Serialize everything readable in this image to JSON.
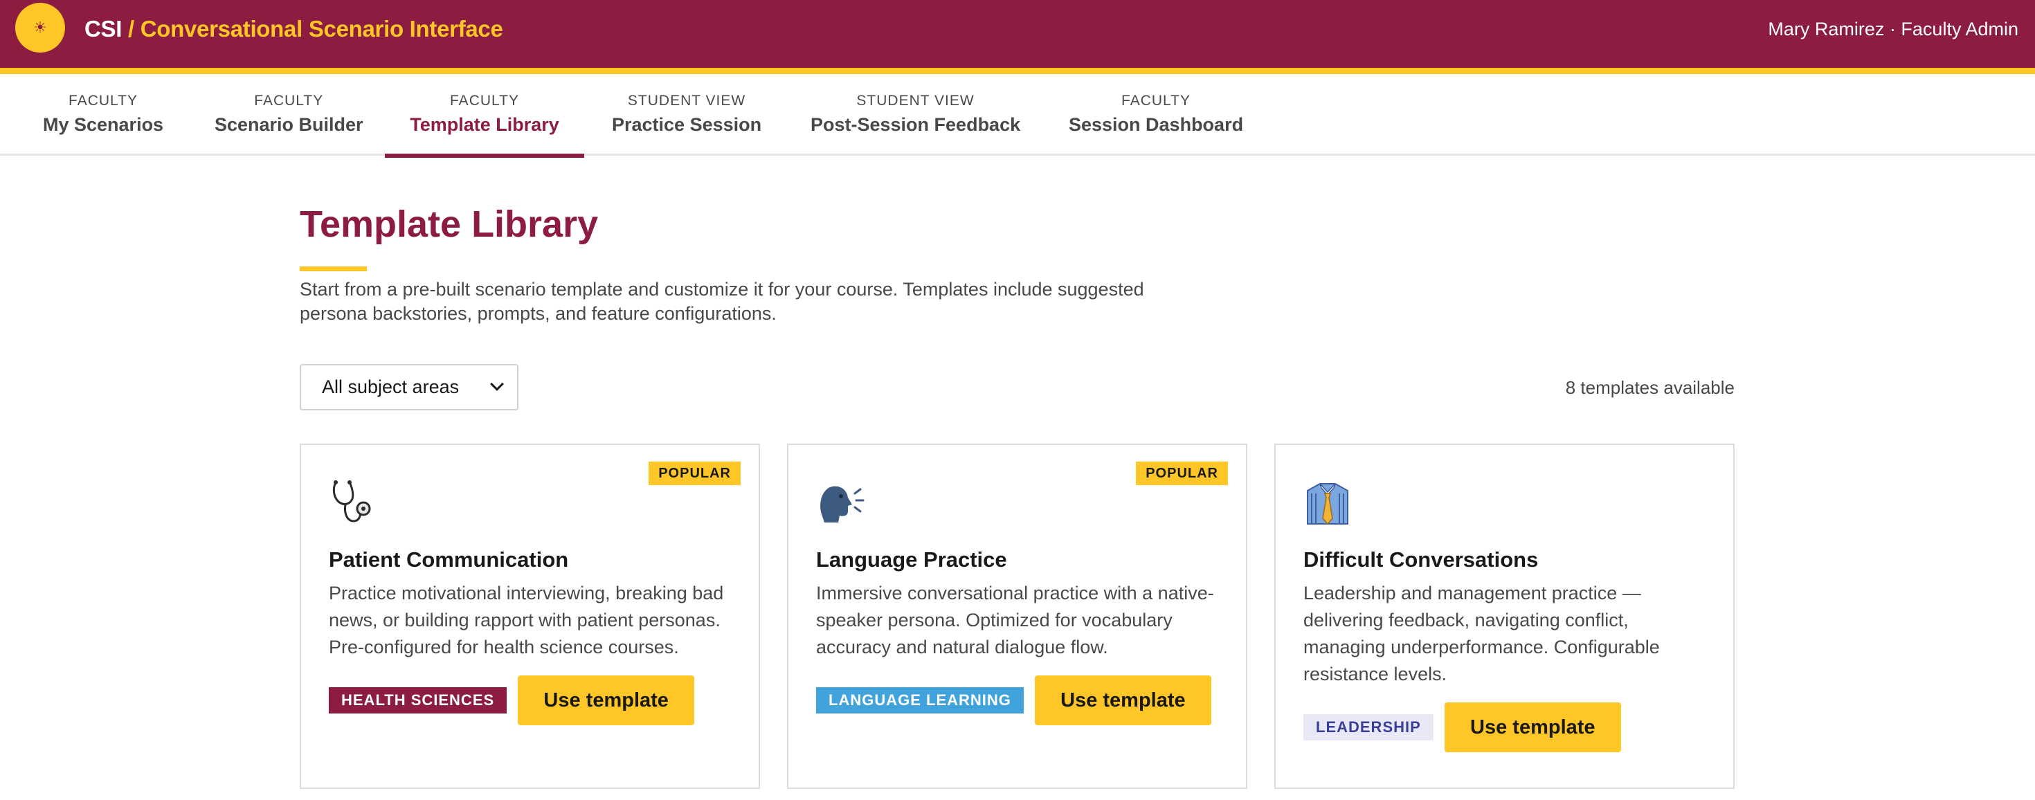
{
  "header": {
    "logo_glyph": "☀",
    "brand_short": "CSI",
    "brand_sep": "/",
    "brand_full": "Conversational Scenario Interface",
    "user": "Mary Ramirez · Faculty Admin",
    "colors": {
      "maroon": "#8c1d40",
      "gold": "#ffc627"
    }
  },
  "tabs": [
    {
      "kind": "FACULTY",
      "name": "My Scenarios"
    },
    {
      "kind": "FACULTY",
      "name": "Scenario Builder"
    },
    {
      "kind": "FACULTY",
      "name": "Template Library"
    },
    {
      "kind": "STUDENT VIEW",
      "name": "Practice Session"
    },
    {
      "kind": "STUDENT VIEW",
      "name": "Post-Session Feedback"
    },
    {
      "kind": "FACULTY",
      "name": "Session Dashboard"
    }
  ],
  "active_tab": "Template Library",
  "page": {
    "title": "Template Library",
    "intro": "Start from a pre-built scenario template and customize it for your course. Templates include suggested persona backstories, prompts, and feature configurations.",
    "filter_value": "All subject areas",
    "count": "8 templates available"
  },
  "cards": [
    {
      "icon": "stethoscope-icon",
      "badge": "POPULAR",
      "title": "Patient Communication",
      "description": "Practice motivational interviewing, breaking bad news, or building rapport with patient personas. Pre-configured for health science courses.",
      "tag": "HEALTH SCIENCES",
      "button": "Use template"
    },
    {
      "icon": "speaking-head-icon",
      "badge": "POPULAR",
      "title": "Language Practice",
      "description": "Immersive conversational practice with a native-speaker persona. Optimized for vocabulary accuracy and natural dialogue flow.",
      "tag": "LANGUAGE LEARNING",
      "button": "Use template"
    },
    {
      "icon": "shirt-tie-icon",
      "badge": "",
      "title": "Difficult Conversations",
      "description": "Leadership and management practice — delivering feedback, navigating conflict, managing underperformance. Configurable resistance levels.",
      "tag": "LEADERSHIP",
      "button": "Use template"
    }
  ]
}
